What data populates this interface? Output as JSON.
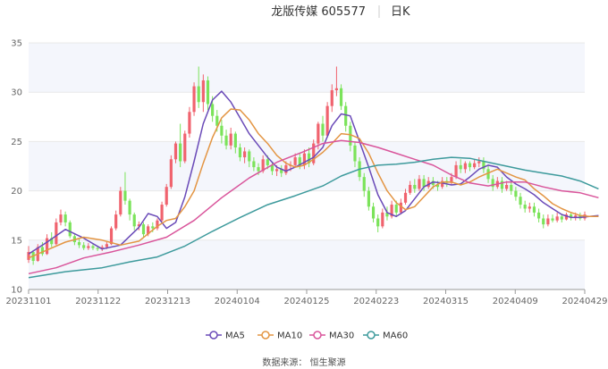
{
  "header": {
    "stock": "龙版传媒 605577",
    "period": "日K"
  },
  "source_label": "数据来源： 恒生聚源",
  "colors": {
    "up": "#f0636e",
    "down": "#7be35a",
    "band": "#f4f6fc",
    "grid": "#e8e8e8",
    "axis": "#999999",
    "ma5": "#6a4ab8",
    "ma10": "#e39543",
    "ma30": "#d9559b",
    "ma60": "#3d9a9c"
  },
  "chart_data": {
    "type": "candlestick",
    "x_tick_labels": [
      "20231101",
      "20231122",
      "20231213",
      "20240104",
      "20240125",
      "20240223",
      "20240315",
      "20240409",
      "20240429"
    ],
    "y_ticks": [
      10,
      15,
      20,
      25,
      30,
      35
    ],
    "ylim": [
      10,
      35
    ],
    "legend": [
      {
        "name": "MA5",
        "key": "ma5"
      },
      {
        "name": "MA10",
        "key": "ma10"
      },
      {
        "name": "MA30",
        "key": "ma30"
      },
      {
        "name": "MA60",
        "key": "ma60"
      }
    ],
    "candles": [
      [
        13.0,
        13.8,
        14.4,
        12.7
      ],
      [
        13.8,
        12.9,
        14.0,
        12.5
      ],
      [
        12.9,
        14.3,
        14.6,
        12.8
      ],
      [
        14.3,
        13.6,
        14.8,
        13.4
      ],
      [
        13.6,
        15.2,
        15.6,
        13.5
      ],
      [
        15.2,
        14.6,
        15.8,
        14.3
      ],
      [
        14.6,
        16.8,
        17.2,
        14.5
      ],
      [
        16.8,
        17.6,
        18.1,
        16.5
      ],
      [
        17.6,
        16.8,
        17.9,
        16.4
      ],
      [
        16.8,
        15.4,
        17.0,
        15.2
      ],
      [
        15.4,
        14.8,
        15.6,
        14.5
      ],
      [
        14.8,
        14.5,
        15.1,
        14.2
      ],
      [
        14.5,
        14.2,
        14.8,
        14.0
      ],
      [
        14.2,
        14.4,
        14.7,
        14.0
      ],
      [
        14.4,
        14.2,
        14.6,
        14.0
      ],
      [
        14.2,
        14.1,
        14.4,
        13.9
      ],
      [
        14.1,
        14.3,
        14.5,
        13.9
      ],
      [
        14.3,
        14.6,
        14.8,
        14.1
      ],
      [
        14.6,
        16.2,
        16.4,
        14.5
      ],
      [
        16.2,
        17.6,
        18.0,
        16.0
      ],
      [
        17.6,
        20.0,
        20.4,
        17.4
      ],
      [
        20.0,
        19.0,
        21.9,
        18.6
      ],
      [
        19.0,
        17.6,
        19.2,
        17.0
      ],
      [
        17.6,
        16.4,
        17.8,
        16.0
      ],
      [
        16.4,
        16.6,
        16.9,
        16.0
      ],
      [
        16.6,
        15.6,
        16.8,
        15.2
      ],
      [
        15.6,
        16.4,
        16.6,
        15.4
      ],
      [
        16.4,
        16.2,
        16.8,
        15.8
      ],
      [
        16.2,
        17.0,
        17.2,
        16.0
      ],
      [
        17.0,
        18.6,
        18.9,
        16.9
      ],
      [
        18.6,
        20.4,
        20.7,
        18.4
      ],
      [
        20.4,
        23.2,
        23.6,
        20.2
      ],
      [
        23.2,
        24.8,
        25.0,
        22.8
      ],
      [
        24.8,
        23.0,
        26.8,
        22.4
      ],
      [
        23.0,
        25.8,
        26.1,
        22.8
      ],
      [
        25.8,
        28.0,
        28.5,
        25.4
      ],
      [
        28.0,
        30.6,
        31.0,
        27.6
      ],
      [
        30.6,
        29.0,
        32.6,
        28.4
      ],
      [
        29.0,
        31.2,
        31.8,
        28.0
      ],
      [
        31.2,
        28.8,
        31.6,
        28.2
      ],
      [
        28.8,
        27.6,
        29.6,
        27.0
      ],
      [
        27.6,
        26.6,
        28.2,
        26.0
      ],
      [
        26.6,
        25.6,
        27.2,
        24.8
      ],
      [
        25.6,
        24.6,
        26.2,
        24.2
      ],
      [
        24.6,
        25.8,
        26.4,
        24.2
      ],
      [
        25.8,
        24.4,
        26.0,
        23.8
      ],
      [
        24.4,
        23.4,
        24.8,
        23.0
      ],
      [
        23.4,
        24.0,
        24.4,
        22.8
      ],
      [
        24.0,
        23.0,
        24.2,
        22.4
      ],
      [
        23.0,
        22.4,
        23.4,
        22.0
      ],
      [
        22.4,
        22.0,
        22.8,
        21.6
      ],
      [
        22.0,
        23.2,
        23.6,
        21.8
      ],
      [
        23.2,
        22.6,
        23.6,
        22.2
      ],
      [
        22.6,
        22.0,
        22.9,
        21.6
      ],
      [
        22.0,
        22.2,
        22.6,
        21.5
      ],
      [
        22.2,
        21.8,
        22.6,
        21.4
      ],
      [
        21.8,
        22.6,
        23.0,
        21.6
      ],
      [
        22.6,
        22.6,
        23.0,
        22.0
      ],
      [
        22.6,
        23.4,
        23.8,
        22.4
      ],
      [
        23.4,
        22.6,
        23.8,
        22.2
      ],
      [
        22.6,
        23.8,
        24.2,
        22.2
      ],
      [
        23.8,
        22.8,
        24.4,
        22.4
      ],
      [
        22.8,
        24.8,
        25.2,
        22.6
      ],
      [
        24.8,
        26.8,
        27.0,
        24.2
      ],
      [
        26.8,
        25.6,
        27.6,
        25.0
      ],
      [
        25.6,
        28.6,
        29.0,
        25.4
      ],
      [
        28.6,
        30.2,
        30.8,
        28.0
      ],
      [
        30.2,
        30.4,
        32.6,
        29.6
      ],
      [
        30.4,
        28.6,
        30.8,
        28.2
      ],
      [
        28.6,
        26.6,
        29.0,
        26.0
      ],
      [
        26.6,
        24.6,
        27.0,
        24.0
      ],
      [
        24.6,
        23.0,
        25.0,
        22.4
      ],
      [
        23.0,
        21.4,
        23.4,
        21.0
      ],
      [
        21.4,
        20.0,
        21.8,
        19.4
      ],
      [
        20.0,
        18.4,
        20.4,
        18.0
      ],
      [
        18.4,
        17.2,
        18.8,
        16.8
      ],
      [
        17.2,
        16.4,
        17.6,
        15.8
      ],
      [
        16.4,
        17.8,
        18.2,
        16.2
      ],
      [
        17.8,
        17.4,
        18.4,
        17.0
      ],
      [
        17.4,
        18.6,
        19.0,
        17.2
      ],
      [
        18.6,
        17.8,
        19.0,
        17.4
      ],
      [
        17.8,
        18.8,
        19.2,
        17.6
      ],
      [
        18.8,
        19.8,
        20.2,
        18.6
      ],
      [
        19.8,
        20.6,
        21.0,
        19.6
      ],
      [
        20.6,
        20.2,
        21.2,
        19.8
      ],
      [
        20.2,
        21.2,
        21.6,
        20.0
      ],
      [
        21.2,
        20.4,
        21.6,
        20.0
      ],
      [
        20.4,
        21.0,
        21.4,
        20.2
      ],
      [
        21.0,
        20.6,
        21.4,
        20.2
      ],
      [
        20.6,
        20.4,
        21.0,
        20.0
      ],
      [
        20.4,
        21.0,
        21.4,
        20.2
      ],
      [
        21.0,
        20.8,
        21.4,
        20.4
      ],
      [
        20.8,
        21.4,
        21.8,
        20.6
      ],
      [
        21.4,
        22.6,
        23.0,
        21.2
      ],
      [
        22.6,
        22.2,
        23.2,
        21.8
      ],
      [
        22.2,
        22.8,
        23.0,
        21.8
      ],
      [
        22.8,
        22.4,
        23.0,
        22.0
      ],
      [
        22.4,
        22.8,
        23.2,
        22.2
      ],
      [
        22.8,
        23.0,
        23.4,
        22.4
      ],
      [
        23.0,
        22.2,
        23.4,
        21.8
      ],
      [
        22.2,
        21.2,
        22.6,
        20.8
      ],
      [
        21.2,
        20.4,
        21.6,
        20.0
      ],
      [
        20.4,
        21.0,
        21.4,
        20.2
      ],
      [
        21.0,
        20.2,
        21.4,
        19.8
      ],
      [
        20.2,
        20.6,
        21.0,
        20.0
      ],
      [
        20.6,
        20.0,
        21.0,
        19.6
      ],
      [
        20.0,
        19.4,
        20.4,
        19.0
      ],
      [
        19.4,
        18.6,
        19.8,
        18.2
      ],
      [
        18.6,
        18.2,
        19.0,
        17.8
      ],
      [
        18.2,
        18.4,
        18.8,
        17.8
      ],
      [
        18.4,
        17.8,
        18.8,
        17.4
      ],
      [
        17.8,
        17.2,
        18.2,
        16.8
      ],
      [
        17.2,
        16.6,
        17.6,
        16.2
      ],
      [
        16.6,
        17.2,
        17.6,
        16.4
      ],
      [
        17.2,
        17.0,
        17.6,
        16.8
      ],
      [
        17.0,
        17.4,
        17.8,
        16.8
      ],
      [
        17.4,
        17.1,
        17.6,
        16.8
      ],
      [
        17.1,
        17.6,
        17.8,
        17.0
      ],
      [
        17.6,
        17.3,
        17.8,
        17.0
      ],
      [
        17.3,
        17.5,
        17.8,
        17.0
      ],
      [
        17.5,
        17.2,
        17.8,
        17.0
      ],
      [
        17.2,
        17.6,
        17.9,
        17.0
      ]
    ],
    "ma5": [
      [
        0,
        13.6
      ],
      [
        4,
        14.8
      ],
      [
        8,
        16.1
      ],
      [
        12,
        15.2
      ],
      [
        16,
        14.1
      ],
      [
        20,
        14.5
      ],
      [
        24,
        16.3
      ],
      [
        26,
        17.7
      ],
      [
        28,
        17.4
      ],
      [
        30,
        16.2
      ],
      [
        32,
        16.8
      ],
      [
        34,
        19.4
      ],
      [
        36,
        23.0
      ],
      [
        38,
        26.8
      ],
      [
        40,
        29.2
      ],
      [
        42,
        30.1
      ],
      [
        44,
        29.0
      ],
      [
        46,
        27.4
      ],
      [
        48,
        25.8
      ],
      [
        50,
        24.6
      ],
      [
        52,
        23.4
      ],
      [
        54,
        22.4
      ],
      [
        56,
        22.0
      ],
      [
        58,
        22.4
      ],
      [
        60,
        22.9
      ],
      [
        62,
        23.4
      ],
      [
        64,
        24.4
      ],
      [
        66,
        26.6
      ],
      [
        68,
        27.8
      ],
      [
        70,
        27.6
      ],
      [
        72,
        25.0
      ],
      [
        74,
        22.4
      ],
      [
        76,
        19.6
      ],
      [
        78,
        17.8
      ],
      [
        80,
        17.4
      ],
      [
        82,
        18.0
      ],
      [
        84,
        19.2
      ],
      [
        86,
        20.4
      ],
      [
        88,
        20.9
      ],
      [
        90,
        20.8
      ],
      [
        92,
        20.6
      ],
      [
        94,
        20.7
      ],
      [
        96,
        21.4
      ],
      [
        98,
        22.2
      ],
      [
        100,
        22.6
      ],
      [
        102,
        22.4
      ],
      [
        104,
        21.4
      ],
      [
        106,
        20.7
      ],
      [
        108,
        20.2
      ],
      [
        110,
        19.6
      ],
      [
        112,
        18.8
      ],
      [
        114,
        18.2
      ],
      [
        116,
        17.6
      ],
      [
        118,
        17.3
      ],
      [
        120,
        17.3
      ],
      [
        122,
        17.4
      ],
      [
        124,
        17.5
      ]
    ],
    "ma10": [
      [
        0,
        13.2
      ],
      [
        4,
        14.0
      ],
      [
        8,
        14.8
      ],
      [
        12,
        15.3
      ],
      [
        16,
        15.0
      ],
      [
        20,
        14.5
      ],
      [
        24,
        14.9
      ],
      [
        28,
        16.4
      ],
      [
        30,
        17.0
      ],
      [
        32,
        17.2
      ],
      [
        34,
        18.4
      ],
      [
        36,
        20.0
      ],
      [
        38,
        22.8
      ],
      [
        40,
        25.4
      ],
      [
        42,
        27.4
      ],
      [
        44,
        28.3
      ],
      [
        46,
        28.2
      ],
      [
        48,
        27.2
      ],
      [
        50,
        25.8
      ],
      [
        52,
        24.8
      ],
      [
        54,
        23.6
      ],
      [
        56,
        22.8
      ],
      [
        58,
        22.4
      ],
      [
        60,
        22.6
      ],
      [
        62,
        23.2
      ],
      [
        64,
        23.9
      ],
      [
        66,
        24.8
      ],
      [
        68,
        25.8
      ],
      [
        70,
        25.7
      ],
      [
        72,
        25.3
      ],
      [
        74,
        23.8
      ],
      [
        76,
        21.8
      ],
      [
        78,
        20.0
      ],
      [
        80,
        18.8
      ],
      [
        82,
        18.1
      ],
      [
        84,
        18.4
      ],
      [
        86,
        19.4
      ],
      [
        88,
        20.4
      ],
      [
        90,
        20.9
      ],
      [
        92,
        20.9
      ],
      [
        94,
        20.6
      ],
      [
        96,
        20.9
      ],
      [
        98,
        21.4
      ],
      [
        100,
        21.8
      ],
      [
        102,
        22.2
      ],
      [
        104,
        21.8
      ],
      [
        106,
        21.4
      ],
      [
        108,
        21.1
      ],
      [
        110,
        20.2
      ],
      [
        112,
        19.5
      ],
      [
        114,
        18.7
      ],
      [
        116,
        18.2
      ],
      [
        118,
        17.8
      ],
      [
        120,
        17.5
      ],
      [
        122,
        17.4
      ],
      [
        124,
        17.4
      ]
    ],
    "ma30": [
      [
        0,
        11.6
      ],
      [
        6,
        12.2
      ],
      [
        12,
        13.2
      ],
      [
        18,
        13.8
      ],
      [
        24,
        14.5
      ],
      [
        30,
        15.3
      ],
      [
        36,
        17.0
      ],
      [
        42,
        19.3
      ],
      [
        48,
        21.3
      ],
      [
        54,
        22.9
      ],
      [
        60,
        24.0
      ],
      [
        64,
        24.8
      ],
      [
        68,
        25.1
      ],
      [
        72,
        24.9
      ],
      [
        76,
        24.4
      ],
      [
        80,
        23.8
      ],
      [
        84,
        23.2
      ],
      [
        88,
        22.6
      ],
      [
        92,
        21.6
      ],
      [
        96,
        20.8
      ],
      [
        100,
        20.5
      ],
      [
        104,
        20.9
      ],
      [
        108,
        20.9
      ],
      [
        112,
        20.4
      ],
      [
        116,
        20.0
      ],
      [
        120,
        19.8
      ],
      [
        124,
        19.3
      ]
    ],
    "ma60": [
      [
        0,
        11.2
      ],
      [
        8,
        11.8
      ],
      [
        16,
        12.2
      ],
      [
        22,
        12.8
      ],
      [
        28,
        13.3
      ],
      [
        34,
        14.4
      ],
      [
        40,
        15.9
      ],
      [
        46,
        17.3
      ],
      [
        52,
        18.6
      ],
      [
        58,
        19.5
      ],
      [
        64,
        20.5
      ],
      [
        68,
        21.5
      ],
      [
        72,
        22.2
      ],
      [
        76,
        22.6
      ],
      [
        80,
        22.7
      ],
      [
        84,
        22.9
      ],
      [
        88,
        23.2
      ],
      [
        92,
        23.4
      ],
      [
        96,
        23.3
      ],
      [
        100,
        22.9
      ],
      [
        104,
        22.5
      ],
      [
        108,
        22.1
      ],
      [
        112,
        21.8
      ],
      [
        116,
        21.5
      ],
      [
        120,
        21.0
      ],
      [
        124,
        20.2
      ]
    ]
  }
}
